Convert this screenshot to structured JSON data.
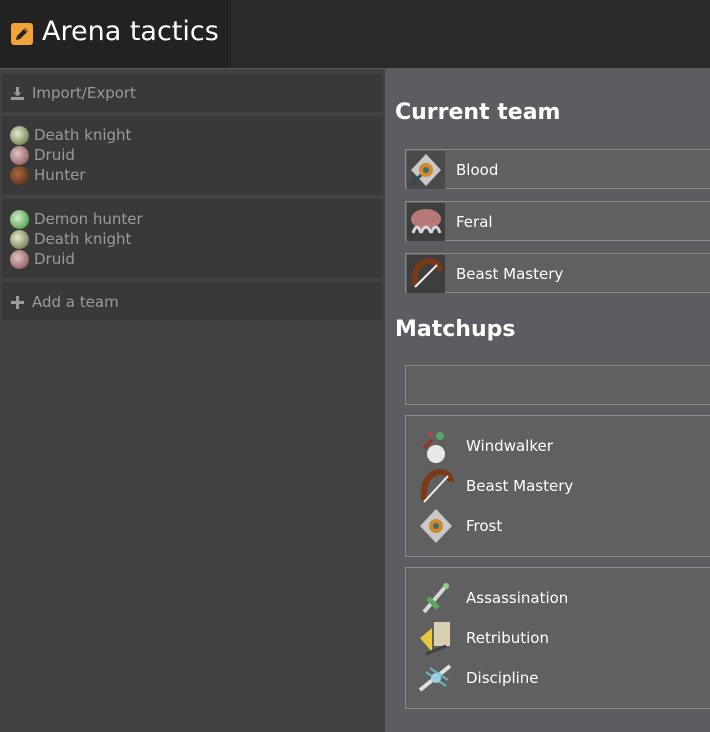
{
  "app": {
    "title": "Arena tactics",
    "title_icon": "pencil-icon",
    "accent_color": "#f2a33a"
  },
  "sidebar": {
    "import_export": {
      "label": "Import/Export",
      "icon": "download-icon"
    },
    "teams": [
      {
        "members": [
          {
            "name": "Death knight",
            "icon": "death-knight-icon",
            "color": "#c9cfa4"
          },
          {
            "name": "Druid",
            "icon": "druid-icon",
            "color": "#b58a8a"
          },
          {
            "name": "Hunter",
            "icon": "hunter-icon",
            "color": "#6b3a20"
          }
        ]
      },
      {
        "members": [
          {
            "name": "Demon hunter",
            "icon": "demon-hunter-icon",
            "color": "#7fc07a"
          },
          {
            "name": "Death knight",
            "icon": "death-knight-icon",
            "color": "#c9cfa4"
          },
          {
            "name": "Druid",
            "icon": "druid-icon",
            "color": "#b58a8a"
          }
        ]
      }
    ],
    "add_team": {
      "label": "Add a team",
      "icon": "plus-icon"
    }
  },
  "main": {
    "current_team_heading": "Current team",
    "current_team": [
      {
        "name": "Blood",
        "icon": "blood-spec-icon"
      },
      {
        "name": "Feral",
        "icon": "feral-spec-icon"
      },
      {
        "name": "Beast Mastery",
        "icon": "beast-mastery-spec-icon"
      }
    ],
    "matchups_heading": "Matchups",
    "matchups": [
      {
        "specs": [
          {
            "name": "Windwalker",
            "icon": "windwalker-spec-icon"
          },
          {
            "name": "Beast Mastery",
            "icon": "beast-mastery-spec-icon"
          },
          {
            "name": "Frost",
            "icon": "frost-spec-icon"
          }
        ]
      },
      {
        "specs": [
          {
            "name": "Assassination",
            "icon": "assassination-spec-icon"
          },
          {
            "name": "Retribution",
            "icon": "retribution-spec-icon"
          },
          {
            "name": "Discipline",
            "icon": "discipline-spec-icon"
          }
        ]
      }
    ]
  }
}
